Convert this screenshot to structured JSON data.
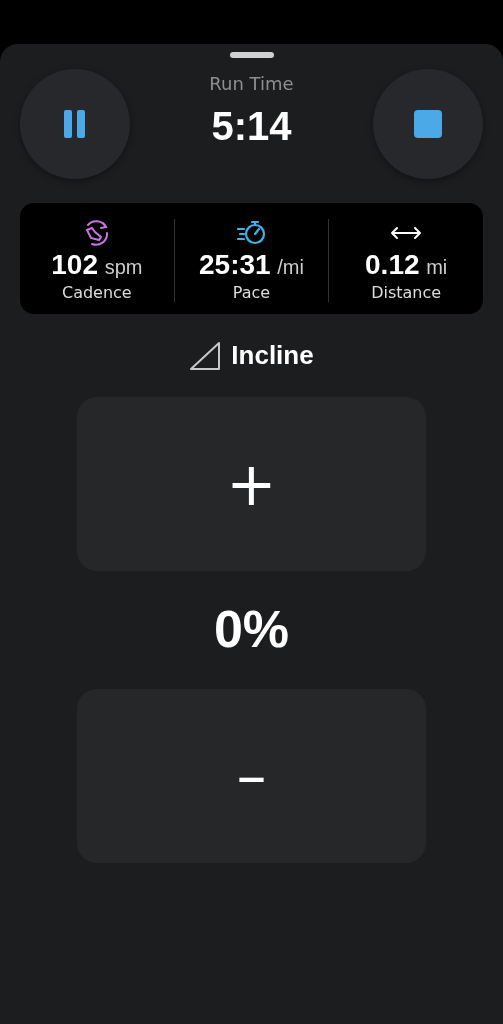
{
  "controls": [
    {
      "kind": "pause"
    },
    {
      "kind": "stop"
    }
  ],
  "run_time": {
    "label": "Run Time",
    "value": "5:14"
  },
  "stats": [
    {
      "kind": "cadence",
      "value": "102",
      "unit": "spm",
      "label": "Cadence"
    },
    {
      "kind": "pace",
      "value": "25:31",
      "unit": "/mi",
      "label": "Pace"
    },
    {
      "kind": "distance",
      "value": "0.12",
      "unit": "mi",
      "label": "Distance"
    }
  ],
  "incline": {
    "label": "Incline",
    "value": "0%",
    "increase": "+",
    "decrease": "–"
  }
}
